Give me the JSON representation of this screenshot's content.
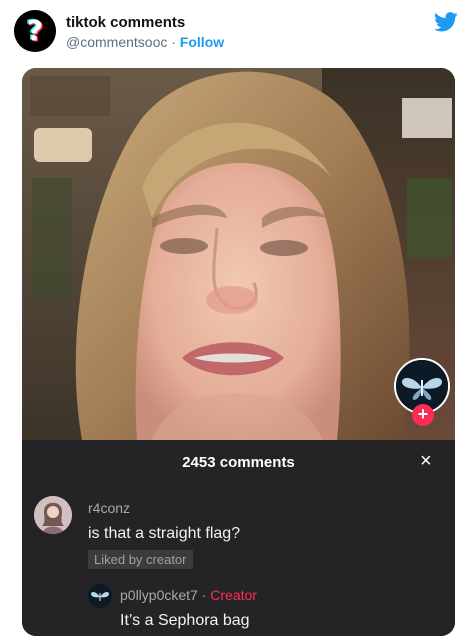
{
  "header": {
    "account_name": "tiktok comments",
    "handle": "@commentsooc",
    "separator": " · ",
    "follow_label": "Follow",
    "avatar_icon": "question-mark-icon",
    "brand_icon": "twitter-bird-icon",
    "colors": {
      "follow": "#1d9bf0",
      "twitter": "#1d9bf0"
    }
  },
  "video": {
    "creator_avatar_icon": "butterfly-icon",
    "follow_plus": "+",
    "colors": {
      "plus": "#fe2c55"
    }
  },
  "comments_panel": {
    "title": "2453 comments",
    "close_icon": "×",
    "comment": {
      "username": "r4conz",
      "text": "is that a straight flag?",
      "liked_badge": "Liked by creator"
    },
    "reply": {
      "username": "p0llyp0cket7",
      "separator": " · ",
      "creator_tag": "Creator",
      "text": "It’s a Sephora bag"
    },
    "colors": {
      "background": "#242426",
      "creator_tag": "#fe2c55"
    }
  }
}
